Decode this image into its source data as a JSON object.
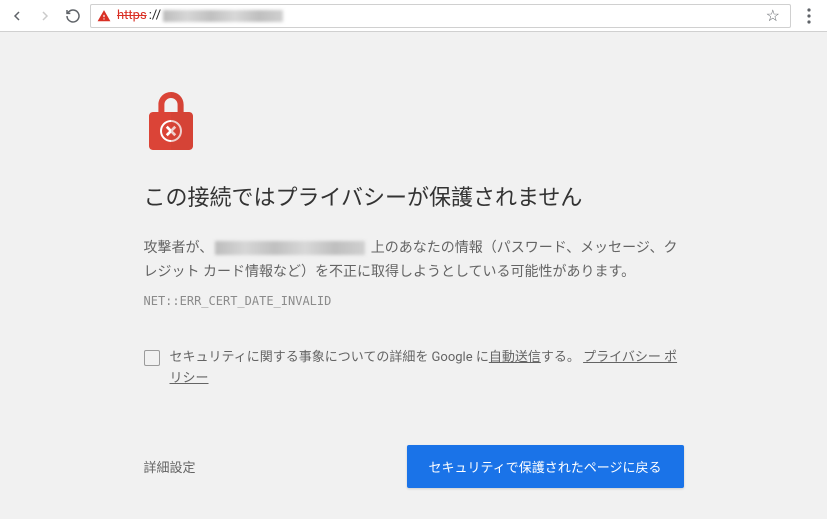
{
  "toolbar": {
    "url_scheme": "https",
    "url_scheme_struck": true,
    "url_separator": "://"
  },
  "page": {
    "headline": "この接続ではプライバシーが保護されません",
    "body_prefix": "攻撃者が、",
    "body_suffix": " 上のあなたの情報（パスワード、メッセージ、クレジット カード情報など）を不正に取得しようとしている可能性があります。",
    "error_code": "NET::ERR_CERT_DATE_INVALID",
    "checkbox_text_before": "セキュリティに関する事象についての詳細を Google に",
    "checkbox_link1": "自動送信",
    "checkbox_text_mid": "する。",
    "checkbox_link2": "プライバシー ポリシー",
    "advanced_label": "詳細設定",
    "primary_label": "セキュリティで保護されたページに戻る"
  }
}
